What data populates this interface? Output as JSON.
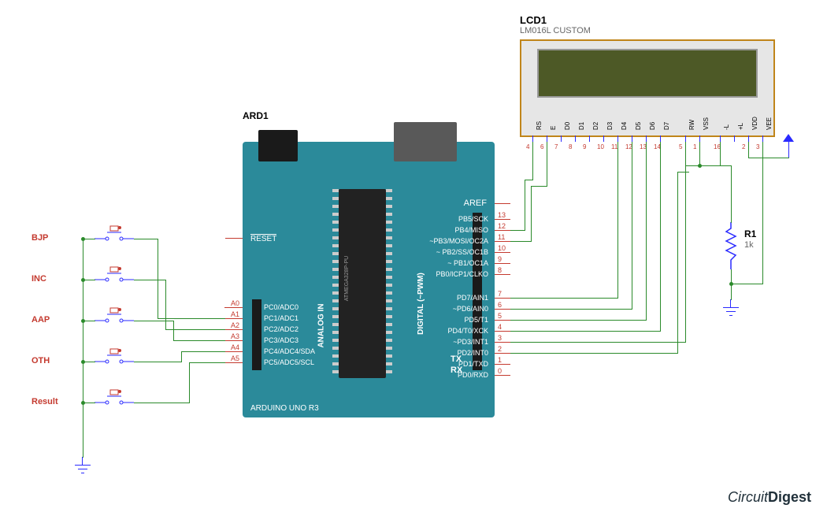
{
  "watermark": {
    "prefix": "Circuit",
    "suffix": "Digest"
  },
  "arduino": {
    "ref": "ARD1",
    "name": "ARDUINO UNO R3",
    "chip": "ATMEGA328P-PU",
    "reset": "RESET",
    "aref": "AREF",
    "analog_header": "ANALOG IN",
    "digital_header": "DIGITAL (~PWM)",
    "tx": "TX",
    "rx": "RX",
    "analog_nums": [
      "A0",
      "A1",
      "A2",
      "A3",
      "A4",
      "A5"
    ],
    "analog_pins": [
      "PC0/ADC0",
      "PC1/ADC1",
      "PC2/ADC2",
      "PC3/ADC3",
      "PC4/ADC4/SDA",
      "PC5/ADC5/SCL"
    ],
    "digital_top": {
      "nums": [
        "13",
        "12",
        "11",
        "10",
        "9",
        "8"
      ],
      "pins": [
        "PB5/SCK",
        "PB4/MISO",
        "~PB3/MOSI/OC2A",
        "~ PB2/SS/OC1B",
        "~ PB1/OC1A",
        "PB0/ICP1/CLKO"
      ]
    },
    "digital_bottom": {
      "nums": [
        "7",
        "6",
        "5",
        "4",
        "3",
        "2",
        "1",
        "0"
      ],
      "pins": [
        "PD7/AIN1",
        "~PD6/AIN0",
        "PD5/T1",
        "PD4/T0/XCK",
        "~PD3/INT1",
        "PD2/INT0",
        "PD1/TXD",
        "PD0/RXD"
      ]
    }
  },
  "lcd": {
    "ref": "LCD1",
    "model": "LM016L CUSTOM",
    "pins": [
      {
        "name": "RS",
        "num": "4"
      },
      {
        "name": "E",
        "num": "6"
      },
      {
        "name": "D0",
        "num": "7"
      },
      {
        "name": "D1",
        "num": "8"
      },
      {
        "name": "D2",
        "num": "9"
      },
      {
        "name": "D3",
        "num": "10"
      },
      {
        "name": "D4",
        "num": "11"
      },
      {
        "name": "D5",
        "num": "12"
      },
      {
        "name": "D6",
        "num": "13"
      },
      {
        "name": "D7",
        "num": "14"
      },
      {
        "name": "RW",
        "num": "5"
      },
      {
        "name": "VSS",
        "num": "1"
      },
      {
        "name": "-L",
        "num": "16"
      },
      {
        "name": "+L",
        "num": ""
      },
      {
        "name": "VDD",
        "num": "2"
      },
      {
        "name": "VEE",
        "num": "3"
      }
    ]
  },
  "resistor": {
    "ref": "R1",
    "value": "1k"
  },
  "buttons": [
    {
      "label": "BJP"
    },
    {
      "label": "INC"
    },
    {
      "label": "AAP"
    },
    {
      "label": "OTH"
    },
    {
      "label": "Result"
    }
  ]
}
